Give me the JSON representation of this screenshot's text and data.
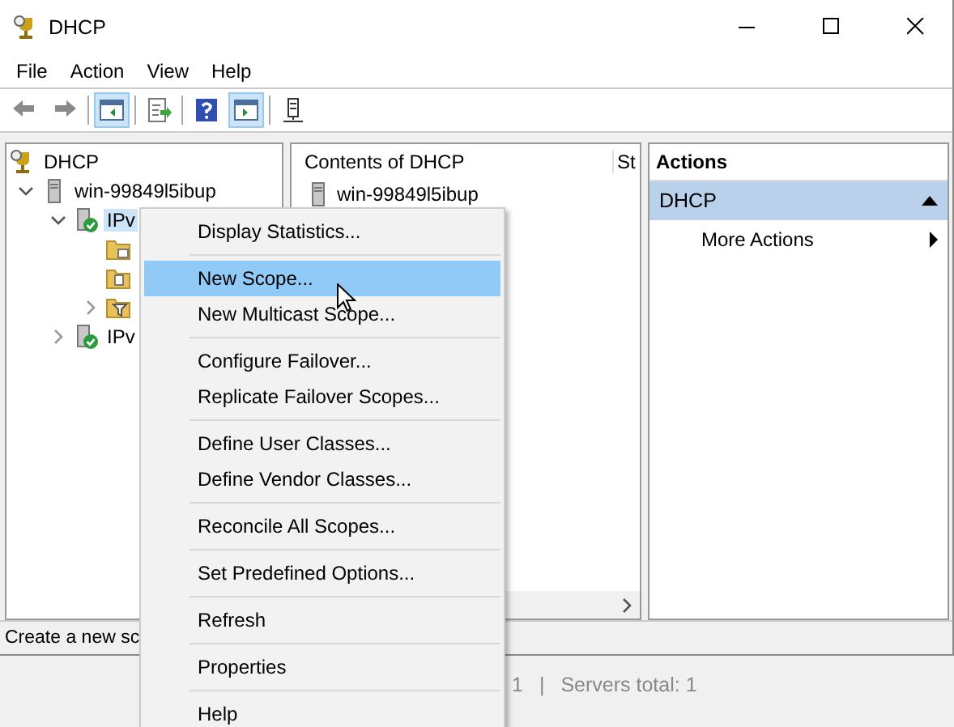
{
  "window": {
    "title": "DHCP"
  },
  "menu_bar": [
    "File",
    "Action",
    "View",
    "Help"
  ],
  "toolbar": [
    {
      "kind": "back",
      "selected": false
    },
    {
      "kind": "forward",
      "selected": false
    },
    {
      "kind": "pane",
      "selected": true
    },
    {
      "kind": "export",
      "selected": false
    },
    {
      "kind": "help",
      "selected": false
    },
    {
      "kind": "pane2",
      "selected": true
    },
    {
      "kind": "server",
      "selected": false
    }
  ],
  "tree": [
    {
      "label": "DHCP",
      "kind": "root",
      "selected": false,
      "children": [
        {
          "label": "win-99849l5ibup",
          "kind": "server",
          "expanded": true,
          "selected": false,
          "children": [
            {
              "label": "IPv",
              "kind": "protocol",
              "expanded": true,
              "selected": true,
              "children": [
                {
                  "kind": "folder"
                },
                {
                  "kind": "options"
                },
                {
                  "kind": "filter",
                  "expanded": false
                }
              ]
            },
            {
              "label": "IPv",
              "kind": "protocol",
              "expanded": false,
              "selected": false
            }
          ]
        }
      ]
    }
  ],
  "contents": {
    "title": "Contents of DHCP",
    "column_2": "St",
    "rows": [
      "win-99849l5ibup"
    ]
  },
  "actions": {
    "title": "Actions",
    "section": "DHCP",
    "items": [
      "More Actions"
    ]
  },
  "status_bar": "Create a new sc",
  "background_status": [
    "1",
    "|",
    "Servers total: 1"
  ],
  "context_menu": [
    {
      "kind": "item",
      "label": "Display Statistics...",
      "selected": false
    },
    {
      "kind": "separator"
    },
    {
      "kind": "item",
      "label": "New Scope...",
      "selected": true
    },
    {
      "kind": "item",
      "label": "New Multicast Scope...",
      "selected": false
    },
    {
      "kind": "separator"
    },
    {
      "kind": "item",
      "label": "Configure Failover...",
      "selected": false
    },
    {
      "kind": "item",
      "label": "Replicate Failover Scopes...",
      "selected": false
    },
    {
      "kind": "separator"
    },
    {
      "kind": "item",
      "label": "Define User Classes...",
      "selected": false
    },
    {
      "kind": "item",
      "label": "Define Vendor Classes...",
      "selected": false
    },
    {
      "kind": "separator"
    },
    {
      "kind": "item",
      "label": "Reconcile All Scopes...",
      "selected": false
    },
    {
      "kind": "separator"
    },
    {
      "kind": "item",
      "label": "Set Predefined Options...",
      "selected": false
    },
    {
      "kind": "separator"
    },
    {
      "kind": "item",
      "label": "Refresh",
      "selected": false
    },
    {
      "kind": "separator"
    },
    {
      "kind": "item",
      "label": "Properties",
      "selected": false
    },
    {
      "kind": "separator"
    },
    {
      "kind": "item",
      "label": "Help",
      "selected": false
    }
  ]
}
